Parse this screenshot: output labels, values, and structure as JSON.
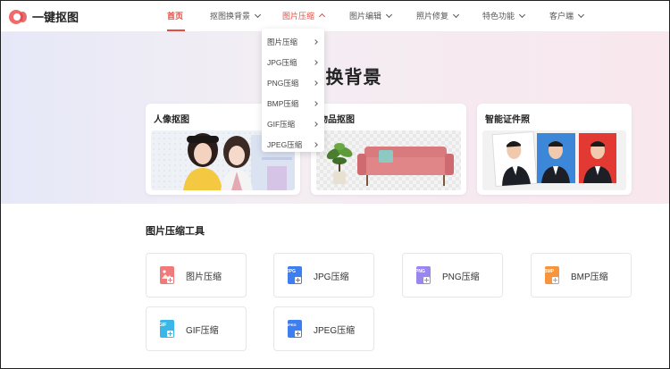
{
  "brand": {
    "name": "一键抠图"
  },
  "nav": [
    {
      "label": "首页",
      "state": "active"
    },
    {
      "label": "抠图换背景",
      "state": "normal"
    },
    {
      "label": "图片压缩",
      "state": "open"
    },
    {
      "label": "图片编辑",
      "state": "normal"
    },
    {
      "label": "照片修复",
      "state": "normal"
    },
    {
      "label": "特色功能",
      "state": "normal"
    },
    {
      "label": "客户端",
      "state": "normal"
    }
  ],
  "dropdown": {
    "items": [
      {
        "label": "图片压缩"
      },
      {
        "label": "JPG压缩"
      },
      {
        "label": "PNG压缩"
      },
      {
        "label": "BMP压缩"
      },
      {
        "label": "GIF压缩"
      },
      {
        "label": "JPEG压缩"
      }
    ]
  },
  "hero": {
    "title": "抠图换背景",
    "cards": [
      {
        "title": "人像抠图"
      },
      {
        "title": "物品抠图"
      },
      {
        "title": "智能证件照"
      }
    ]
  },
  "tools": {
    "title": "图片压缩工具",
    "items": [
      {
        "label": "图片压缩",
        "icon": "image-compress-icon",
        "badge": "",
        "color": "#f07a7a"
      },
      {
        "label": "JPG压缩",
        "icon": "jpg-file-icon",
        "badge": "JPG",
        "color": "#3d7ff0"
      },
      {
        "label": "PNG压缩",
        "icon": "png-file-icon",
        "badge": "PNG",
        "color": "#9a86ee"
      },
      {
        "label": "BMP压缩",
        "icon": "bmp-file-icon",
        "badge": "BMP",
        "color": "#f5953e"
      },
      {
        "label": "GIF压缩",
        "icon": "gif-file-icon",
        "badge": "GIF",
        "color": "#3bb6e8"
      },
      {
        "label": "JPEG压缩",
        "icon": "jpeg-file-icon",
        "badge": "JPEG",
        "color": "#3d7ff0"
      }
    ]
  },
  "colors": {
    "accent": "#e84c3d"
  }
}
